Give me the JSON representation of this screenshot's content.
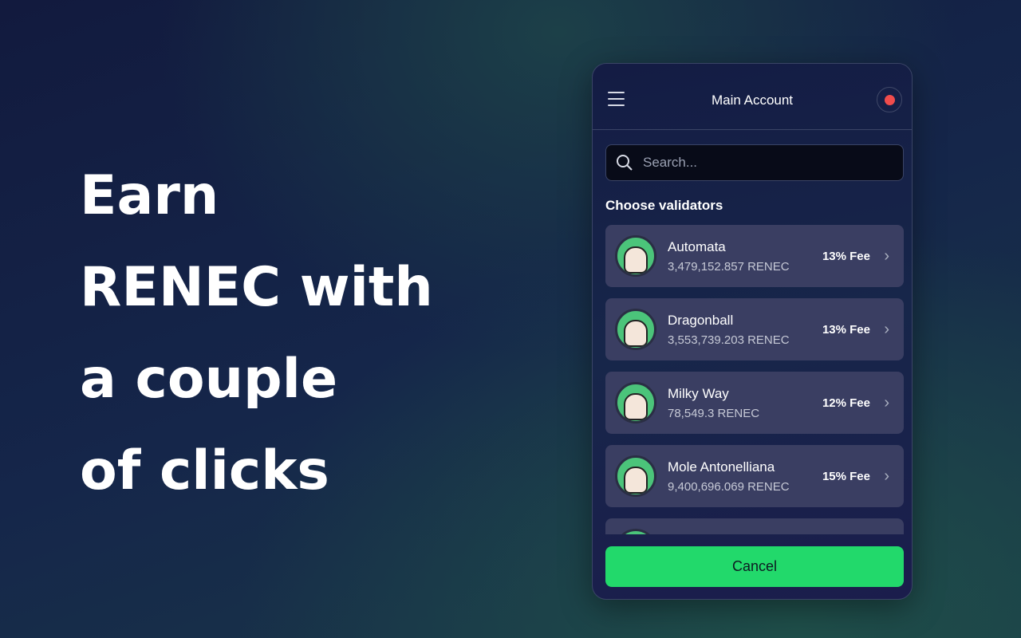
{
  "hero": {
    "lines": [
      "Earn",
      "RENEC with",
      "a couple",
      "of clicks"
    ]
  },
  "header": {
    "title": "Main Account",
    "status_color": "#f04c4c"
  },
  "search": {
    "placeholder": "Search..."
  },
  "section_label": "Choose validators",
  "validators": [
    {
      "name": "Automata",
      "amount": "3,479,152.857 RENEC",
      "fee": "13% Fee"
    },
    {
      "name": "Dragonball",
      "amount": "3,553,739.203 RENEC",
      "fee": "13% Fee"
    },
    {
      "name": "Milky Way",
      "amount": "78,549.3 RENEC",
      "fee": "12% Fee"
    },
    {
      "name": "Mole Antonelliana",
      "amount": "9,400,696.069 RENEC",
      "fee": "15% Fee"
    }
  ],
  "cancel_label": "Cancel",
  "colors": {
    "accent": "#22d96b",
    "card": "#3a3e62"
  }
}
